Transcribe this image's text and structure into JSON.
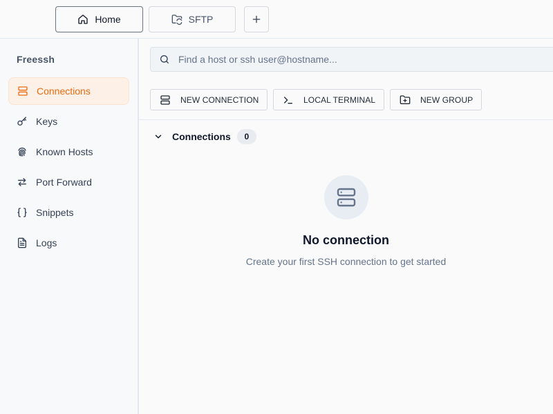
{
  "tabs": [
    {
      "label": "Home",
      "icon": "home-icon",
      "active": true
    },
    {
      "label": "SFTP",
      "icon": "folder-sync-icon",
      "active": false
    }
  ],
  "add_tab_icon": "plus-icon",
  "sidebar": {
    "brand": "Freessh",
    "items": [
      {
        "label": "Connections",
        "icon": "server-icon",
        "active": true
      },
      {
        "label": "Keys",
        "icon": "key-icon"
      },
      {
        "label": "Known Hosts",
        "icon": "fingerprint-icon"
      },
      {
        "label": "Port Forward",
        "icon": "arrows-exchange-icon"
      },
      {
        "label": "Snippets",
        "icon": "braces-icon"
      },
      {
        "label": "Logs",
        "icon": "file-text-icon"
      }
    ]
  },
  "search": {
    "placeholder": "Find a host or ssh user@hostname...",
    "value": ""
  },
  "actions": {
    "new_connection": "NEW CONNECTION",
    "local_terminal": "LOCAL TERMINAL",
    "new_group": "NEW GROUP"
  },
  "group": {
    "title": "Connections",
    "count": "0"
  },
  "empty_state": {
    "title": "No connection",
    "subtitle": "Create your first SSH connection to get started"
  },
  "colors": {
    "accent": "#ea6c12",
    "accent_bg": "#fdf0e6"
  }
}
